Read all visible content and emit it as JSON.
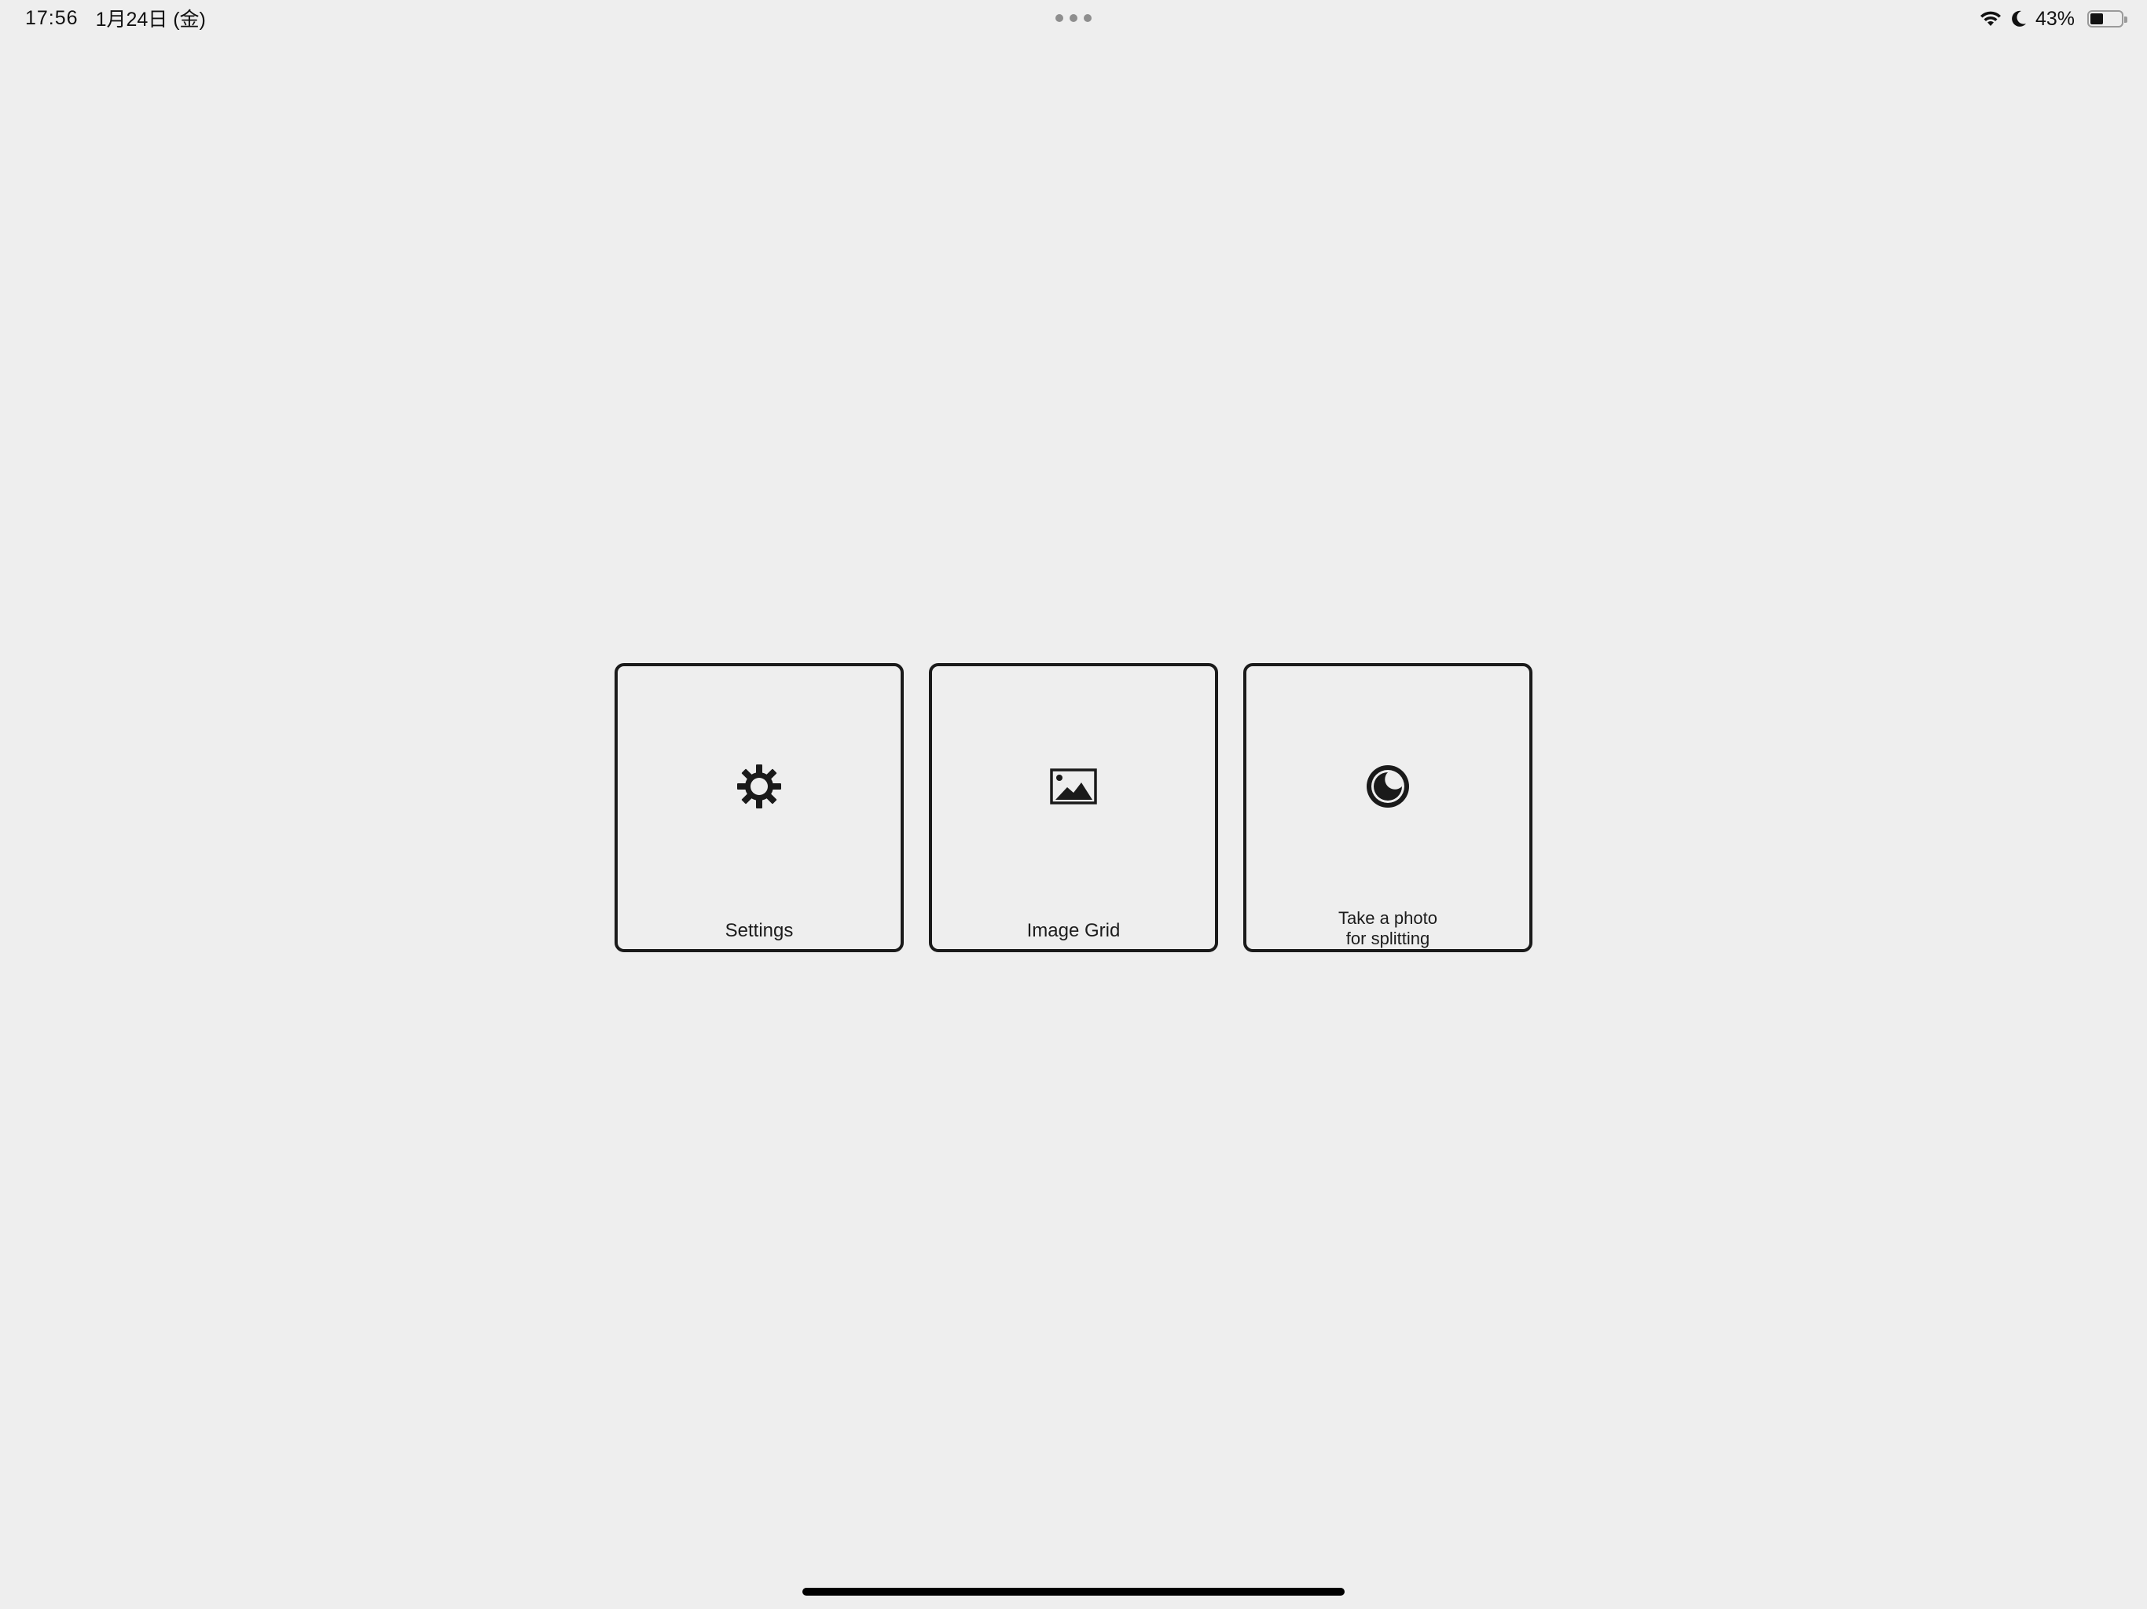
{
  "status_bar": {
    "time": "17:56",
    "date": "1月24日 (金)",
    "battery_percent_text": "43%",
    "battery_level": 0.43,
    "wifi_icon": "wifi-icon",
    "focus_icon": "moon-icon"
  },
  "tiles": [
    {
      "label": "Settings",
      "icon": "gear-icon"
    },
    {
      "label": "Image Grid",
      "icon": "image-icon"
    },
    {
      "label_line1": "Take a photo",
      "label_line2": "for splitting",
      "icon": "camera-shutter-icon"
    }
  ],
  "colors": {
    "background": "#eeeeee",
    "tile_border": "#1a1a1a",
    "text": "#1c1c1c"
  }
}
